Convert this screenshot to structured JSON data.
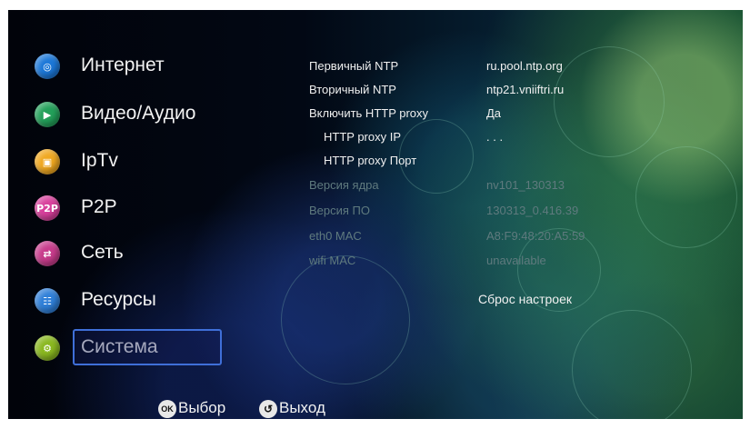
{
  "menu": {
    "items": [
      {
        "label": "Интернет",
        "icon": "globe-icon",
        "color": "#1c78d8",
        "glyph": "◎"
      },
      {
        "label": "Видео/Аудио",
        "icon": "play-icon",
        "color": "#23a05a",
        "glyph": "▶"
      },
      {
        "label": "IpTv",
        "icon": "tv-icon",
        "color": "#f0a820",
        "glyph": "▣"
      },
      {
        "label": "P2P",
        "icon": "p2p-icon",
        "color": "#d8409c",
        "glyph": "P2P"
      },
      {
        "label": "Сеть",
        "icon": "network-icon",
        "color": "#c83c8c",
        "glyph": "⇄"
      },
      {
        "label": "Ресурсы",
        "icon": "resources-icon",
        "color": "#2f7fd8",
        "glyph": "☷"
      },
      {
        "label": "Система",
        "icon": "system-icon",
        "color": "#8ab820",
        "glyph": "⚙"
      }
    ],
    "selected_index": 6
  },
  "settings": {
    "rows": [
      {
        "label": "Первичный NTP",
        "value": "ru.pool.ntp.org",
        "dim": false,
        "indent": false
      },
      {
        "label": "Вторичный NTP",
        "value": "ntp21.vniiftri.ru",
        "dim": false,
        "indent": false
      },
      {
        "label": "Включить HTTP proxy",
        "value": "Да",
        "dim": false,
        "indent": false
      },
      {
        "label": "HTTP proxy IP",
        "value": ".   .   .",
        "dim": false,
        "indent": true
      },
      {
        "label": "HTTP proxy Порт",
        "value": "",
        "dim": false,
        "indent": true
      },
      {
        "label": "Версия ядра",
        "value": "nv101_130313",
        "dim": true,
        "indent": false
      },
      {
        "label": "Версия ПО",
        "value": "130313_0.416.39",
        "dim": true,
        "indent": false
      },
      {
        "label": "eth0 MAC",
        "value": "A8:F9:48:20:A5:59",
        "dim": true,
        "indent": false
      },
      {
        "label": "wifi MAC",
        "value": "unavailable",
        "dim": true,
        "indent": false
      }
    ],
    "reset_label": "Сброс настроек"
  },
  "footer": {
    "ok_icon_text": "OK",
    "select_label": "Выбор",
    "back_icon_text": "↺",
    "exit_label": "Выход"
  }
}
